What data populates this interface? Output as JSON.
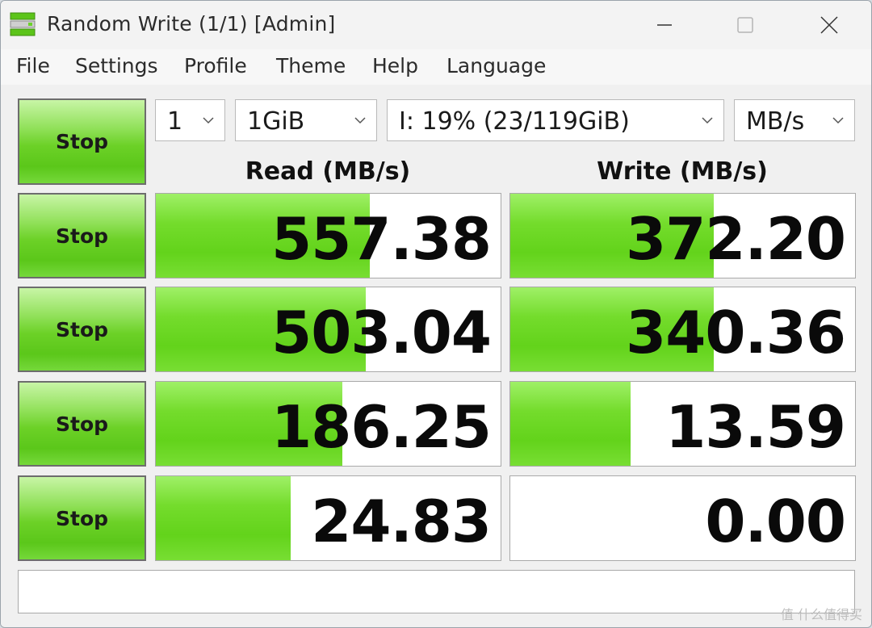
{
  "window": {
    "title": "Random Write (1/1) [Admin]",
    "controls": {
      "minimize": "minimize-icon",
      "maximize": "maximize-icon",
      "close": "close-icon"
    }
  },
  "menu": [
    "File",
    "Settings",
    "Profile",
    "Theme",
    "Help",
    "Language"
  ],
  "controls": {
    "all_button_label": "Stop",
    "count_value": "1",
    "size_value": "1GiB",
    "drive_value": "I: 19% (23/119GiB)",
    "unit_value": "MB/s"
  },
  "columns": {
    "read": "Read (MB/s)",
    "write": "Write (MB/s)"
  },
  "rows": [
    {
      "button": "Stop",
      "read": "557.38",
      "read_level": 0.62,
      "write": "372.20",
      "write_level": 0.59
    },
    {
      "button": "Stop",
      "read": "503.04",
      "read_level": 0.61,
      "write": "340.36",
      "write_level": 0.59
    },
    {
      "button": "Stop",
      "read": "186.25",
      "read_level": 0.54,
      "write": "13.59",
      "write_level": 0.35
    },
    {
      "button": "Stop",
      "read": "24.83",
      "read_level": 0.39,
      "write": "0.00",
      "write_level": 0.0
    }
  ],
  "status_text": "",
  "watermark": "值 什么值得买",
  "colors": {
    "accent_green": "#63d31b",
    "background": "#f0f0f0"
  }
}
